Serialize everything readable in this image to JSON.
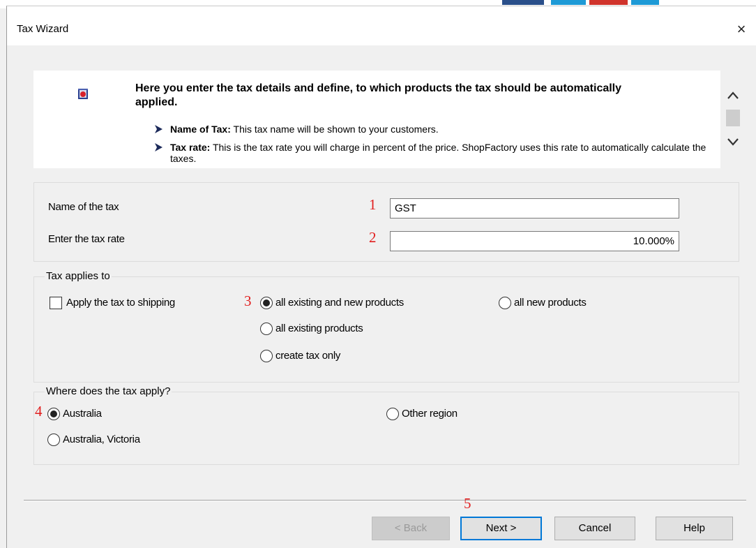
{
  "window": {
    "title": "Tax Wizard",
    "close_glyph": "×"
  },
  "info": {
    "headline": "Here you enter the tax details and define, to which products the tax should be automatically applied.",
    "bullets": [
      {
        "term": "Name of Tax:",
        "text": " This tax name will be shown to your customers."
      },
      {
        "term": "Tax rate:",
        "text": " This is the tax rate you will charge in percent of the price. ShopFactory uses this rate to automatically calculate the taxes."
      }
    ],
    "icons": {
      "book": "book-icon",
      "arrow": "chevron-right-icon",
      "up": "scroll-up-icon",
      "down": "scroll-down-icon"
    }
  },
  "tax_details": {
    "name_label": "Name of the tax",
    "name_value": "GST",
    "rate_label": "Enter the tax rate",
    "rate_value": "10.000%"
  },
  "applies_to": {
    "legend": "Tax applies to",
    "shipping_label": "Apply the tax to shipping",
    "shipping_checked": false,
    "options": [
      {
        "label": "all existing and new products",
        "selected": true
      },
      {
        "label": "all new products",
        "selected": false
      },
      {
        "label": "all existing products",
        "selected": false
      },
      {
        "label": "create tax only",
        "selected": false
      }
    ]
  },
  "region": {
    "legend": "Where does the tax apply?",
    "options": [
      {
        "label": "Australia",
        "selected": true
      },
      {
        "label": "Other region",
        "selected": false
      },
      {
        "label": "Australia, Victoria",
        "selected": false
      }
    ]
  },
  "annotations": [
    "1",
    "2",
    "3",
    "4",
    "5"
  ],
  "buttons": {
    "back": "< Back",
    "next": "Next >",
    "cancel": "Cancel",
    "help": "Help"
  },
  "colors": {
    "annotation": "#e11d1d",
    "focus": "#0078d7",
    "background": "#f0f0f0"
  }
}
